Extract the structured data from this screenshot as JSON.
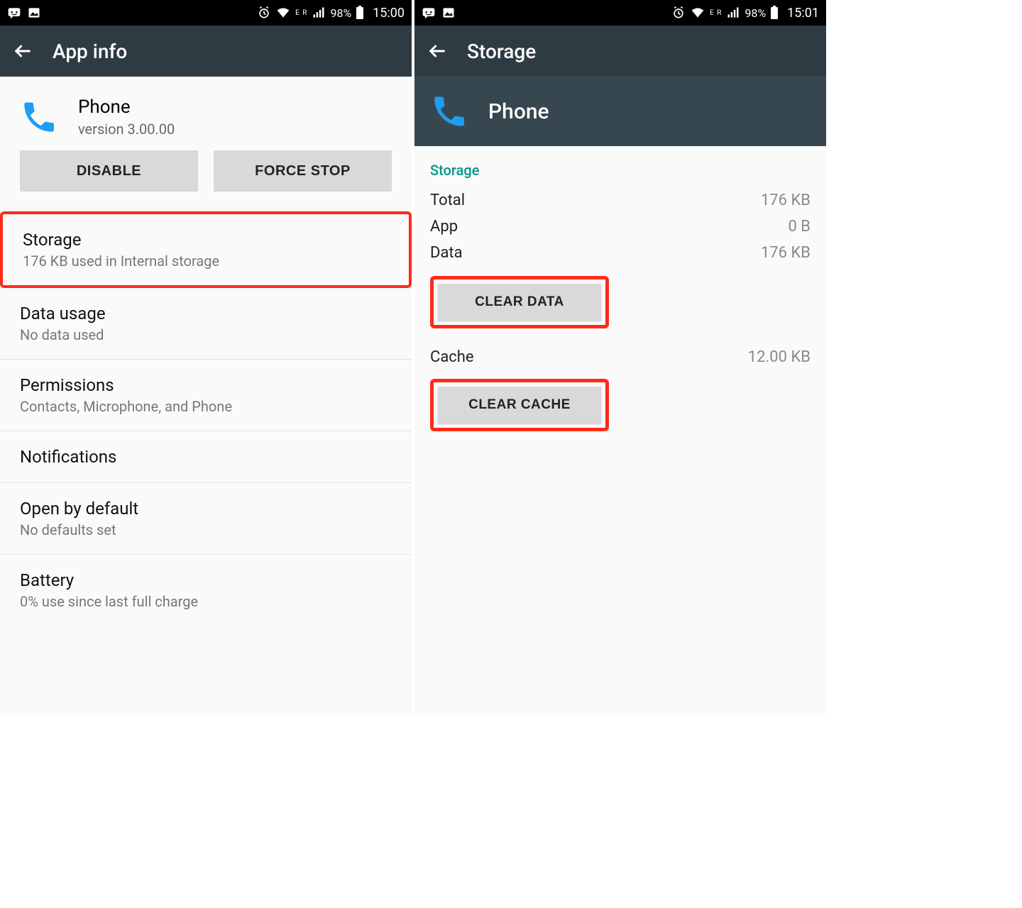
{
  "left_screen": {
    "statusbar": {
      "battery_pct": "98%",
      "clock": "15:00",
      "network_tag": "E R"
    },
    "actionbar": {
      "title": "App info"
    },
    "app": {
      "name": "Phone",
      "version": "version 3.00.00"
    },
    "buttons": {
      "disable": "DISABLE",
      "force_stop": "FORCE STOP"
    },
    "items": [
      {
        "title": "Storage",
        "subtitle": "176 KB used in Internal storage",
        "highlighted": true
      },
      {
        "title": "Data usage",
        "subtitle": "No data used"
      },
      {
        "title": "Permissions",
        "subtitle": "Contacts, Microphone, and Phone"
      },
      {
        "title": "Notifications",
        "subtitle": ""
      },
      {
        "title": "Open by default",
        "subtitle": "No defaults set"
      },
      {
        "title": "Battery",
        "subtitle": "0% use since last full charge"
      }
    ]
  },
  "right_screen": {
    "statusbar": {
      "battery_pct": "98%",
      "clock": "15:01",
      "network_tag": "E R"
    },
    "actionbar": {
      "title": "Storage"
    },
    "app": {
      "name": "Phone"
    },
    "section_label": "Storage",
    "rows": {
      "total": {
        "label": "Total",
        "value": "176 KB"
      },
      "app": {
        "label": "App",
        "value": "0 B"
      },
      "data": {
        "label": "Data",
        "value": "176 KB"
      },
      "cache": {
        "label": "Cache",
        "value": "12.00 KB"
      }
    },
    "buttons": {
      "clear_data": "CLEAR DATA",
      "clear_cache": "CLEAR CACHE"
    }
  }
}
